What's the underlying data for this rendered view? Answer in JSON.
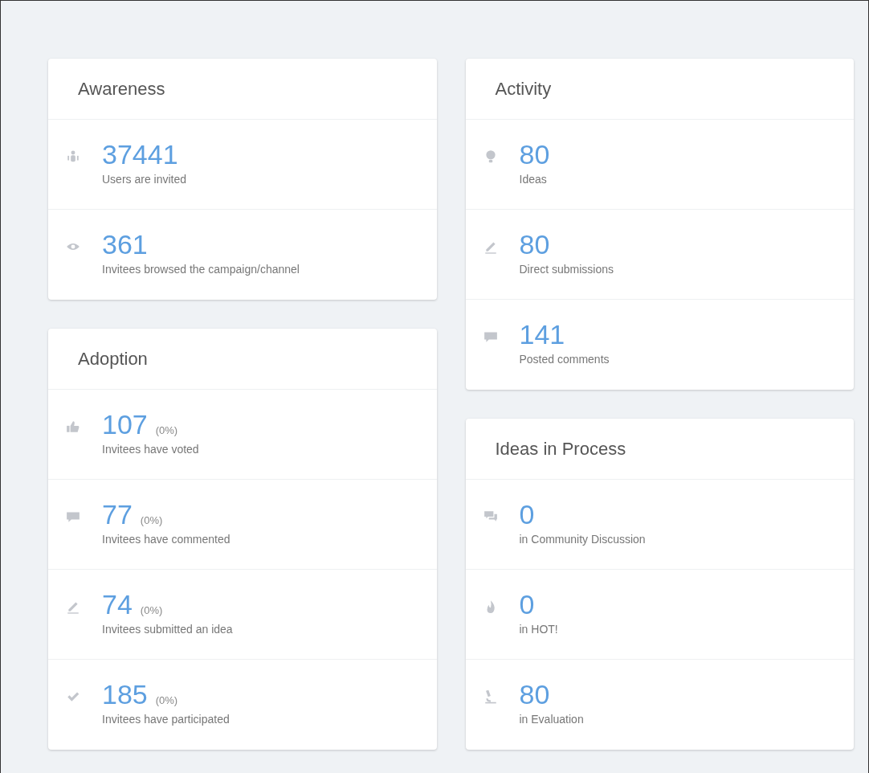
{
  "columns": [
    {
      "cards": [
        {
          "title": "Awareness",
          "rows": [
            {
              "kind": "people",
              "value": "37441",
              "label": "Users are invited"
            },
            {
              "kind": "eye",
              "value": "361",
              "label": "Invitees browsed the campaign/channel"
            }
          ]
        },
        {
          "title": "Adoption",
          "rows": [
            {
              "kind": "thumb",
              "value": "107",
              "percent": "(0%)",
              "label": "Invitees have voted"
            },
            {
              "kind": "comment",
              "value": "77",
              "percent": "(0%)",
              "label": "Invitees have commented"
            },
            {
              "kind": "pencil",
              "value": "74",
              "percent": "(0%)",
              "label": "Invitees submitted an idea"
            },
            {
              "kind": "check",
              "value": "185",
              "percent": "(0%)",
              "label": "Invitees have participated"
            }
          ]
        }
      ]
    },
    {
      "cards": [
        {
          "title": "Activity",
          "rows": [
            {
              "kind": "bulb",
              "value": "80",
              "label": "Ideas"
            },
            {
              "kind": "pencil",
              "value": "80",
              "label": "Direct submissions"
            },
            {
              "kind": "comment",
              "value": "141",
              "label": "Posted comments"
            }
          ]
        },
        {
          "title": "Ideas in Process",
          "rows": [
            {
              "kind": "comments",
              "value": "0",
              "label": "in Community Discussion"
            },
            {
              "kind": "flame",
              "value": "0",
              "label": "in HOT!"
            },
            {
              "kind": "microscope",
              "value": "80",
              "label": "in Evaluation"
            }
          ]
        }
      ]
    }
  ]
}
